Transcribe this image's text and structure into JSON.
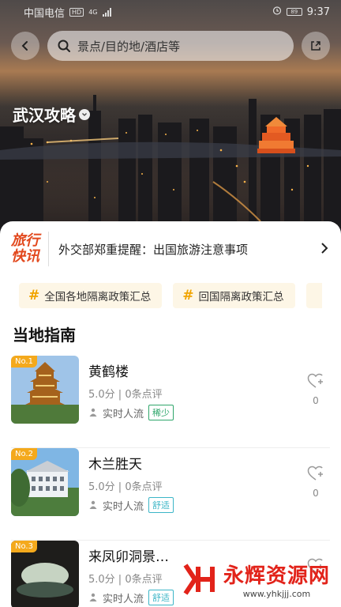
{
  "status": {
    "carrier": "中国电信",
    "hd": "HD",
    "signal": "4G",
    "battery": "89",
    "time": "9:37"
  },
  "search": {
    "placeholder": "景点/目的地/酒店等"
  },
  "city": {
    "title": "武汉攻略"
  },
  "news": {
    "logo_line1": "旅行",
    "logo_line2": "快讯",
    "text": "外交部郑重提醒：出国旅游注意事项"
  },
  "tags": [
    "全国各地隔离政策汇总",
    "回国隔离政策汇总"
  ],
  "section": {
    "title": "当地指南"
  },
  "guides": [
    {
      "rank": "No.1",
      "name": "黄鹤楼",
      "score": "5.0分 | 0条点评",
      "flow_label": "实时人流",
      "flow": "稀少",
      "likes": "0"
    },
    {
      "rank": "No.2",
      "name": "木兰胜天",
      "score": "5.0分 | 0条点评",
      "flow_label": "实时人流",
      "flow": "舒适",
      "likes": "0"
    },
    {
      "rank": "No.3",
      "name": "来凤卯洞景…",
      "score": "5.0分 | 0条点评",
      "flow_label": "实时人流",
      "flow": "舒适",
      "likes": ""
    }
  ],
  "watermark": {
    "brand": "永辉资源网",
    "url": "www.yhkjjj.com"
  },
  "colors": {
    "accent": "#f1a400",
    "rare": "#2fa66b",
    "comfort": "#3cb6c7"
  }
}
